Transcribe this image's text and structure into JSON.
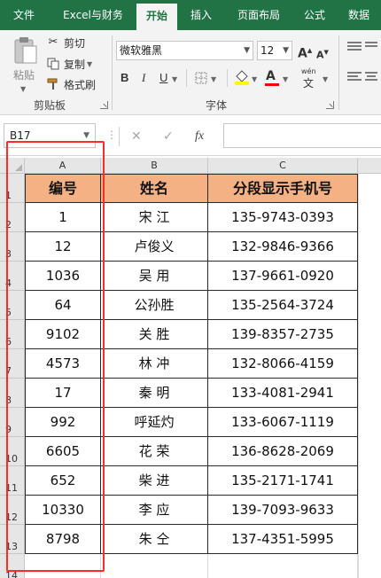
{
  "tabs": [
    {
      "label": "文件",
      "active": false
    },
    {
      "label": "Excel与财务",
      "active": false
    },
    {
      "label": "开始",
      "active": true
    },
    {
      "label": "插入",
      "active": false
    },
    {
      "label": "页面布局",
      "active": false
    },
    {
      "label": "公式",
      "active": false
    },
    {
      "label": "数据",
      "active": false
    }
  ],
  "ribbon": {
    "clipboard": {
      "paste_label": "粘贴",
      "cut_label": "剪切",
      "copy_label": "复制",
      "format_painter_label": "格式刷",
      "group_title": "剪贴板"
    },
    "font": {
      "font_name": "微软雅黑",
      "font_size": "12",
      "bold": "B",
      "italic": "I",
      "underline": "U",
      "font_color_glyph": "A",
      "phonetic_glyph": "wén",
      "group_title": "字体"
    },
    "colors": {
      "accent": "#217346",
      "font_color": "#ff0000",
      "fill_color": "#ffff00"
    },
    "icons": [
      "paste-icon",
      "cut-icon",
      "copy-icon",
      "format-painter-icon",
      "borders-icon",
      "fill-color-icon",
      "font-color-icon",
      "phonetic-icon",
      "align-icon"
    ]
  },
  "formula_bar": {
    "name_box": "B17",
    "cancel_glyph": "✕",
    "enter_glyph": "✓",
    "fx_glyph": "fx",
    "formula": ""
  },
  "sheet": {
    "columns": [
      "A",
      "B",
      "C"
    ],
    "row_numbers": [
      "1",
      "2",
      "3",
      "4",
      "5",
      "6",
      "7",
      "8",
      "9",
      "10",
      "11",
      "12",
      "13",
      "14"
    ],
    "header": [
      "编号",
      "姓名",
      "分段显示手机号"
    ],
    "header_fill": "#f4b183",
    "rows": [
      [
        "1",
        "宋  江",
        "135-9743-0393"
      ],
      [
        "12",
        "卢俊义",
        "132-9846-9366"
      ],
      [
        "1036",
        "吴  用",
        "137-9661-0920"
      ],
      [
        "64",
        "公孙胜",
        "135-2564-3724"
      ],
      [
        "9102",
        "关  胜",
        "139-8357-2735"
      ],
      [
        "4573",
        "林  冲",
        "132-8066-4159"
      ],
      [
        "17",
        "秦  明",
        "133-4081-2941"
      ],
      [
        "992",
        "呼延灼",
        "133-6067-1119"
      ],
      [
        "6605",
        "花  荣",
        "136-8628-2069"
      ],
      [
        "652",
        "柴  进",
        "135-2171-1741"
      ],
      [
        "10330",
        "李  应",
        "139-7093-9633"
      ],
      [
        "8798",
        "朱  仝",
        "137-4351-5995"
      ]
    ],
    "highlight_color": "#ff2a2a"
  }
}
